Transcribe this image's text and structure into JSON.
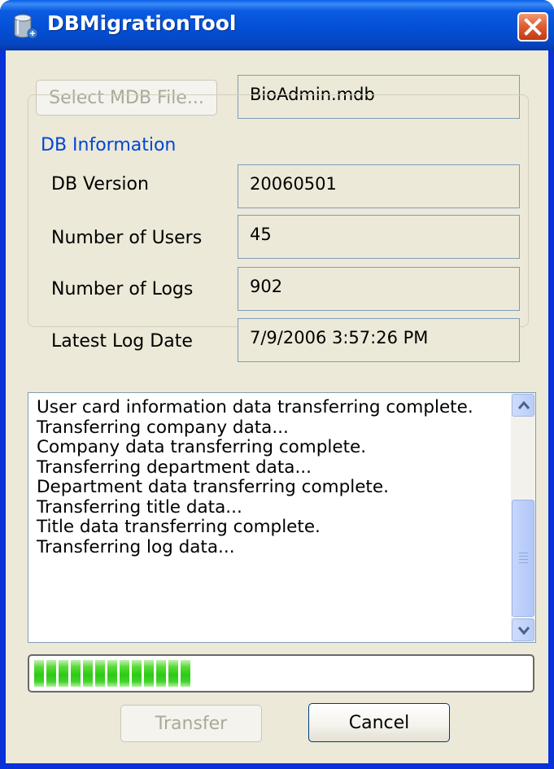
{
  "window": {
    "title": "DBMigrationTool",
    "icon": "database-icon",
    "close_icon": "close-icon"
  },
  "file": {
    "select_button_label": "Select MDB File...",
    "file_name": "BioAdmin.mdb"
  },
  "db_info": {
    "legend": "DB Information",
    "fields": [
      {
        "label": "DB Version",
        "value": "20060501"
      },
      {
        "label": "Number of Users",
        "value": "45"
      },
      {
        "label": "Number of Logs",
        "value": "902"
      },
      {
        "label": "Latest Log Date",
        "value": "7/9/2006 3:57:26 PM"
      }
    ]
  },
  "log": {
    "lines": [
      "User card information data transferring complete.",
      "Transferring company data...",
      "Company data transferring complete.",
      "Transferring department data...",
      "Department data transferring complete.",
      "Transferring title data...",
      "Title data transferring complete.",
      "Transferring log data..."
    ]
  },
  "progress": {
    "fraction": 0.34
  },
  "buttons": {
    "transfer_label": "Transfer",
    "cancel_label": "Cancel"
  },
  "colors": {
    "title_bar": "#0450d6",
    "group_legend": "#0046d5",
    "progress_fill": "#2bcb14",
    "close_button": "#e05f33"
  }
}
